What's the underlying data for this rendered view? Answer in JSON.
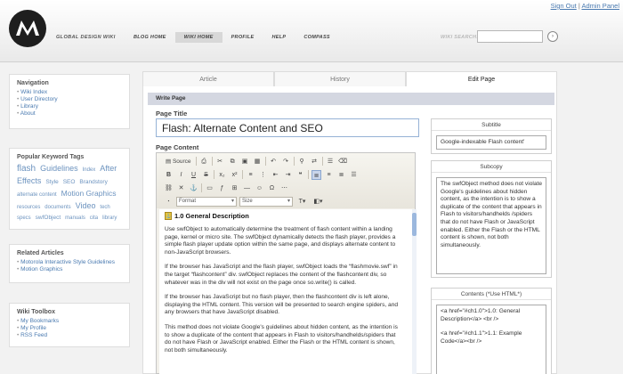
{
  "header": {
    "brand": "GLOBAL DESIGN WIKI",
    "nav": [
      "BLOG HOME",
      "WIKI HOME",
      "PROFILE",
      "HELP",
      "COMPASS"
    ],
    "active_nav": "WIKI HOME",
    "top_links": {
      "sign_out": "Sign Out",
      "separator": "|",
      "admin": "Admin Panel"
    },
    "search_label": "WIKI SEARCH:",
    "search_value": "",
    "search_go": "›"
  },
  "sidebar": {
    "navigation": {
      "title": "Navigation",
      "items": [
        "Wiki Index",
        "User Directory",
        "Library",
        "About"
      ]
    },
    "tags": {
      "title": "Popular Keyword Tags",
      "items": [
        {
          "label": "flash",
          "size": 10
        },
        {
          "label": "Guidelines",
          "size": 9
        },
        {
          "label": "Index",
          "size": 6
        },
        {
          "label": "After",
          "size": 9
        },
        {
          "label": "Effects",
          "size": 9
        },
        {
          "label": "Style",
          "size": 6.5
        },
        {
          "label": "SEO",
          "size": 6.5
        },
        {
          "label": "Brandstory",
          "size": 6.5
        },
        {
          "label": "alternate content",
          "size": 6
        },
        {
          "label": "Motion Graphics",
          "size": 8.5
        },
        {
          "label": "resources",
          "size": 6
        },
        {
          "label": "documents",
          "size": 6
        },
        {
          "label": "Video",
          "size": 9
        },
        {
          "label": "tech",
          "size": 6
        },
        {
          "label": "specs",
          "size": 6
        },
        {
          "label": "swfObject",
          "size": 6.5
        },
        {
          "label": "manuals",
          "size": 6
        },
        {
          "label": "cita",
          "size": 6
        },
        {
          "label": "library",
          "size": 6
        }
      ]
    },
    "related": {
      "title": "Related Articles",
      "items": [
        "Motorola Interactive Style Guidelines",
        "Motion Graphics"
      ]
    },
    "toolbox": {
      "title": "Wiki Toolbox",
      "items": [
        "My Bookmarks",
        "My Profile",
        "RSS Feed"
      ]
    }
  },
  "tabs": [
    {
      "label": "Article",
      "active": false
    },
    {
      "label": "History",
      "active": false
    },
    {
      "label": "Edit Page",
      "active": true
    }
  ],
  "editor": {
    "section_title": "Write Page",
    "page_title_label": "Page Title",
    "page_title_value": "Flash: Alternate Content and SEO",
    "page_content_label": "Page Content",
    "toolbar": {
      "source_label": "Source",
      "format_placeholder": "Format",
      "size_placeholder": "Size"
    },
    "content": {
      "heading": "1.0 General Description",
      "paragraphs": [
        "Use swfObject to automatically determine the treatment of flash content within a landing page, kernel or micro site. The swfObject dynamically detects the flash player, provides a simple flash player update option within the same page, and displays alternate content to non-JavaScript browsers.",
        "If the browser has JavaScript and the flash player, swfObject loads the “flashmovie.swf” in the target “flashcontent” div. swfObject replaces the content of the flashcontent div, so whatever was in the div will not exist on the page once so.write() is called.",
        "If the browser has JavaScript but no flash player, then the flashcontent div is left alone, displaying the HTML content. This version will be presented to search engine spiders, and any browsers that have JavaScript disabled.",
        "This method does not violate Google's guidelines about hidden content, as the intention is to show a duplicate of the content that appears in Flash to visitors/handhelds/spiders that do not have Flash or JavaScript enabled. Either the Flash or the HTML content is shown, not both simultaneously."
      ]
    }
  },
  "right_panels": {
    "subtitle": {
      "label": "Subtitle",
      "value": "Google-indexable Flash content'"
    },
    "subcopy": {
      "label": "Subcopy",
      "value": "The swfObject method does not violate Google's guidelines about hidden content, as the intention is to show a duplicate of the content that appears in Flash to visitors/handhelds /spiders that do not have Flash or JavaScript enabled. Either the Flash or the HTML content is shown, not both simultaneously."
    },
    "contents": {
      "label": "Contents (*Use HTML*)",
      "lines": [
        "<a href=\"#ch1.0\">1.0: General Description</a> <br />",
        "<a href=\"#ch1.1\">1.1: Example Code</a><br />"
      ]
    }
  },
  "colors": {
    "link": "#4a7ab0",
    "tag": "#6c93bf",
    "write_bar": "#d4d7e1",
    "title_border": "#96b2d6"
  }
}
